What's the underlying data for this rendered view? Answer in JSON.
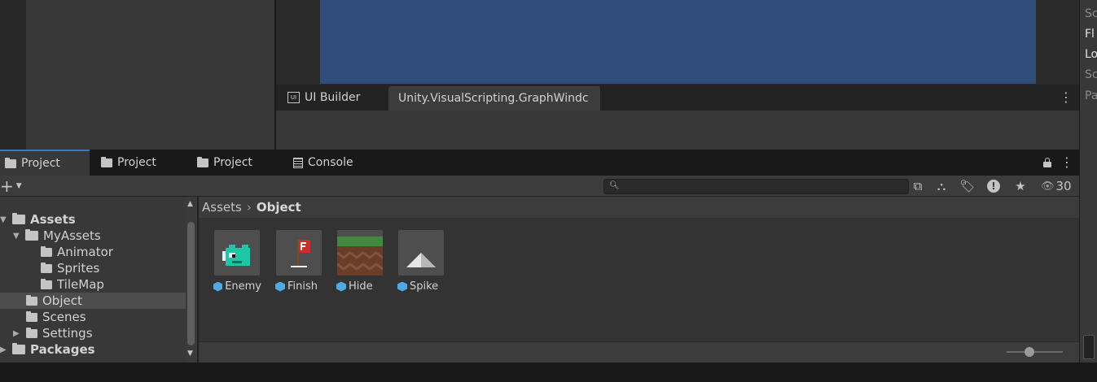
{
  "upper_tabs": [
    {
      "label": "UI Builder",
      "icon": "ui-builder-icon"
    },
    {
      "label": "Unity.VisualScripting.GraphWindc",
      "icon": ""
    }
  ],
  "right_panel_fragments": [
    "Sc",
    "Fl",
    "Lo",
    "Sc",
    "Pa"
  ],
  "project_tabs": [
    {
      "label": "Project",
      "icon": "folder-icon",
      "active": true
    },
    {
      "label": "Project",
      "icon": "folder-icon",
      "active": false
    },
    {
      "label": "Project",
      "icon": "folder-icon",
      "active": false
    },
    {
      "label": "Console",
      "icon": "console-icon",
      "active": false
    }
  ],
  "toolbar": {
    "add_label": "+",
    "search_placeholder": "",
    "visible_count": "30"
  },
  "tree": [
    {
      "label": "Assets",
      "bold": true,
      "expanded": true
    },
    {
      "label": "MyAssets",
      "bold": false,
      "expanded": true
    },
    {
      "label": "Animator"
    },
    {
      "label": "Sprites"
    },
    {
      "label": "TileMap"
    },
    {
      "label": "Object",
      "selected": true
    },
    {
      "label": "Scenes"
    },
    {
      "label": "Settings",
      "collapsed": true
    },
    {
      "label": "Packages",
      "bold": true,
      "collapsed": true
    }
  ],
  "breadcrumb": {
    "root": "Assets",
    "separator": "›",
    "current": "Object"
  },
  "assets": [
    {
      "name": "Enemy"
    },
    {
      "name": "Finish"
    },
    {
      "name": "Hide"
    },
    {
      "name": "Spike"
    }
  ],
  "colors": {
    "accent": "#3a79bb",
    "scene": "#314d79",
    "enemy": "#1fc6a6",
    "flag": "#c9302c"
  }
}
